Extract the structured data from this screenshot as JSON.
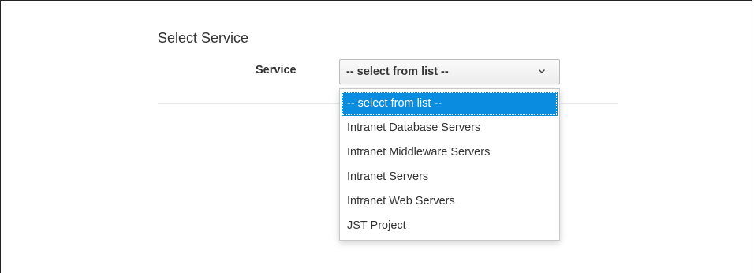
{
  "page": {
    "title": "Select Service"
  },
  "service_field": {
    "label": "Service",
    "selected_value": "-- select from list --",
    "options": [
      "-- select from list --",
      "Intranet Database Servers",
      "Intranet Middleware Servers",
      "Intranet Servers",
      "Intranet Web Servers",
      "JST Project"
    ],
    "highlighted_index": 0,
    "highlight_color": "#0a8de0"
  },
  "icons": {
    "dropdown_arrow": "chevron-down-icon"
  }
}
